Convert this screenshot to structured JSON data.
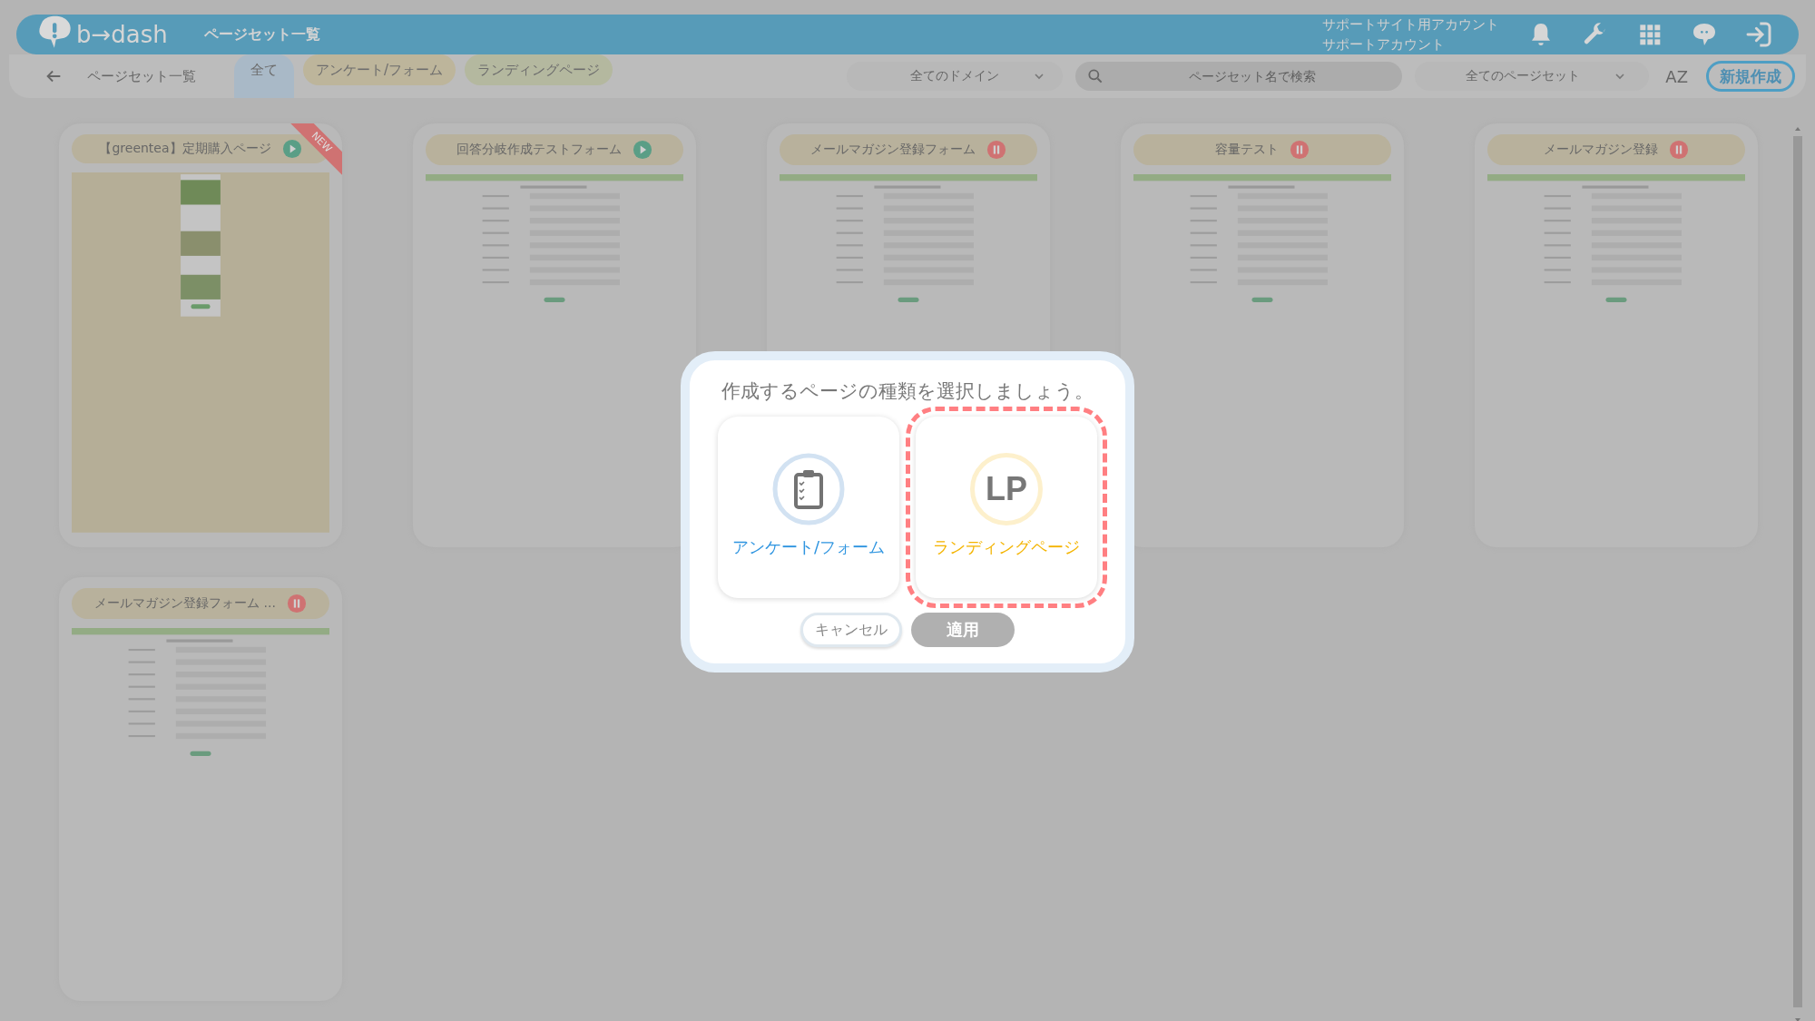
{
  "header": {
    "logo": "b→dash",
    "title": "ページセット一覧",
    "account_lines": [
      "サポートサイト用アカウント",
      "サポートアカウント"
    ]
  },
  "toolbar": {
    "back_label": "ページセット一覧",
    "tabs": [
      {
        "label": "全て",
        "selected": true,
        "color": "#a9b9c7"
      },
      {
        "label": "アンケート/フォーム",
        "selected": false,
        "color": "#bdb59b"
      },
      {
        "label": "ランディングページ",
        "selected": false,
        "color": "#b4b89f"
      }
    ],
    "domain_select": "全てのドメイン",
    "search": {
      "placeholder": "ページセット名で検索"
    },
    "pageset_select": "全てのページセット",
    "sort": "AZ",
    "new_button": "新規作成"
  },
  "cards": [
    {
      "title": "【greentea】定期購入ページ",
      "paused": false,
      "new_badge": "NEW",
      "kind": "landing"
    },
    {
      "title": "回答分岐作成テストフォーム",
      "paused": false,
      "kind": "form"
    },
    {
      "title": "メールマガジン登録フォーム",
      "paused": true,
      "kind": "form"
    },
    {
      "title": "容量テスト",
      "paused": true,
      "kind": "form"
    },
    {
      "title": "メールマガジン登録",
      "paused": true,
      "kind": "form"
    },
    {
      "title": "メールマガジン登録フォーム ...",
      "paused": true,
      "kind": "form"
    }
  ],
  "modal": {
    "title": "作成するページの種類を選択しましょう。",
    "options": [
      {
        "kind": "form",
        "label": "アンケート/フォーム",
        "selected": false
      },
      {
        "kind": "lp",
        "icon_text": "LP",
        "label": "ランディングページ",
        "selected": true
      }
    ],
    "cancel_button": "キャンセル",
    "apply_button": {
      "label": "適用",
      "disabled": true
    }
  }
}
